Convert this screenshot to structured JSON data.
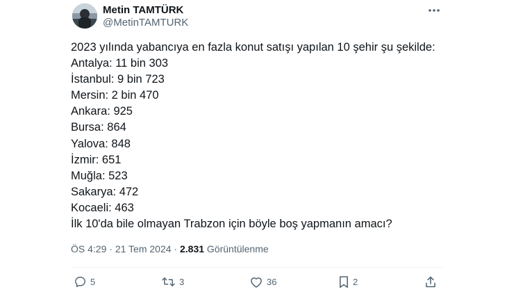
{
  "author": {
    "name": "Metin TAMTÜRK",
    "handle": "@MetinTAMTURK"
  },
  "tweet": {
    "lines": [
      "2023 yılında yabancıya en fazla konut satışı yapılan 10 şehir şu şekilde:",
      "Antalya: 11 bin 303",
      "İstanbul: 9 bin 723",
      "Mersin: 2 bin 470",
      "Ankara: 925",
      "Bursa: 864",
      "Yalova: 848",
      "İzmir: 651",
      "Muğla: 523",
      "Sakarya: 472",
      "Kocaeli: 463",
      "İlk 10'da bile olmayan Trabzon için böyle boş yapmanın amacı?"
    ]
  },
  "meta": {
    "time": "ÖS 4:29",
    "separator": "·",
    "date": "21 Tem 2024",
    "views_count": "2.831",
    "views_label": "Görüntülenme"
  },
  "actions": {
    "replies": "5",
    "retweets": "3",
    "likes": "36",
    "bookmarks": "2"
  },
  "icons": {
    "more": "more-horizontal-icon",
    "reply": "reply-icon",
    "retweet": "retweet-icon",
    "like": "heart-icon",
    "bookmark": "bookmark-icon",
    "share": "share-icon"
  },
  "colors": {
    "text": "#0f1419",
    "secondary": "#536471",
    "divider": "#eff3f4"
  }
}
